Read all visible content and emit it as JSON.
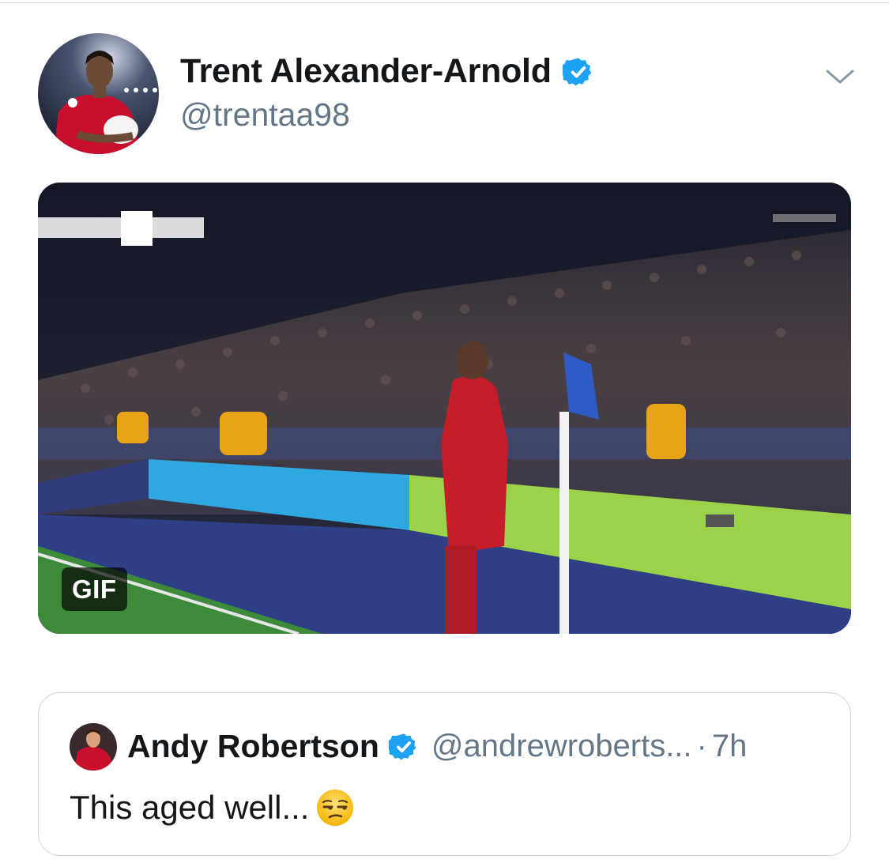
{
  "tweet": {
    "author": {
      "display_name": "Trent Alexander-Arnold",
      "handle": "@trentaa98",
      "verified": true,
      "avatar": "player-portrait-red-kit"
    },
    "menu_icon": "chevron-down-icon",
    "media": {
      "type": "gif",
      "badge_label": "GIF",
      "description_icon": "stadium-corner-flag-scene"
    }
  },
  "quoted_tweet": {
    "author": {
      "display_name": "Andy Robertson",
      "handle": "@andrewroberts...",
      "verified": true,
      "avatar": "player-portrait-red-kit"
    },
    "separator": "·",
    "timestamp": "7h",
    "text": "This aged well...",
    "emoji": "unamused-face-emoji"
  },
  "colors": {
    "verified_blue": "#1da1f2",
    "secondary_text": "#657786",
    "primary_text": "#14171a",
    "border": "#ccd6dd"
  }
}
